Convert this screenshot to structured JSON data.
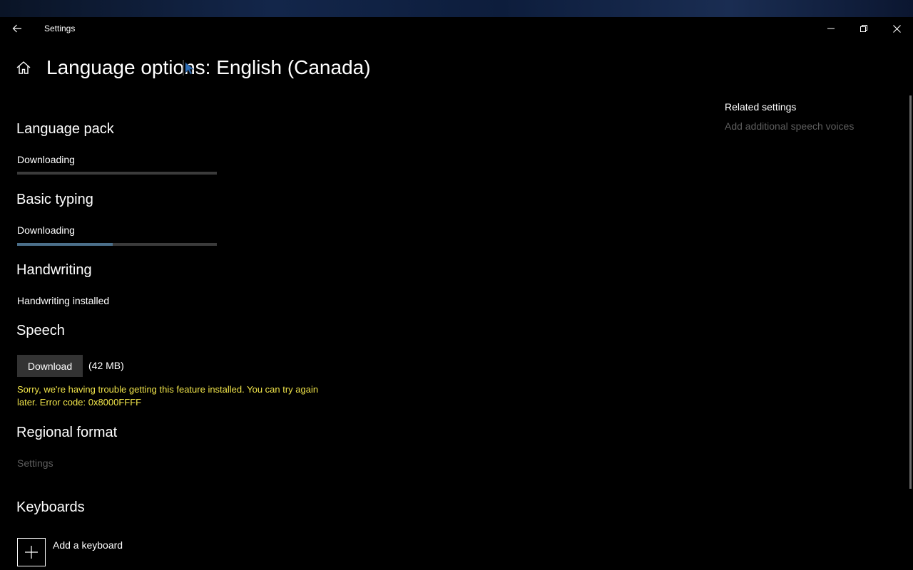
{
  "titlebar": {
    "app_title": "Settings",
    "icons": {
      "back": "back-arrow-icon",
      "minimize": "minimize-icon",
      "restore": "restore-icon",
      "close": "close-icon"
    }
  },
  "header": {
    "home_icon": "home-icon",
    "title": "Language options: English (Canada)"
  },
  "sections": {
    "language_pack": {
      "title": "Language pack",
      "status": "Downloading",
      "progress": 0.0
    },
    "basic_typing": {
      "title": "Basic typing",
      "status": "Downloading",
      "progress": 0.48
    },
    "handwriting": {
      "title": "Handwriting",
      "status": "Handwriting installed"
    },
    "speech": {
      "title": "Speech",
      "download_label": "Download",
      "size": "(42 MB)",
      "error": "Sorry, we're having trouble getting this feature installed. You can try again later. Error code: 0x8000FFFF"
    },
    "regional_format": {
      "title": "Regional format",
      "settings_link": "Settings"
    },
    "keyboards": {
      "title": "Keyboards",
      "add_label": "Add a keyboard",
      "add_icon": "plus-icon"
    }
  },
  "related": {
    "title": "Related settings",
    "link": "Add additional speech voices"
  },
  "colors": {
    "background": "#000000",
    "error": "#f0e44a",
    "disabled": "#5e5e5e",
    "progress_track": "#3b3b3b",
    "progress_fill": "#4b6f8a",
    "button": "#333333"
  }
}
